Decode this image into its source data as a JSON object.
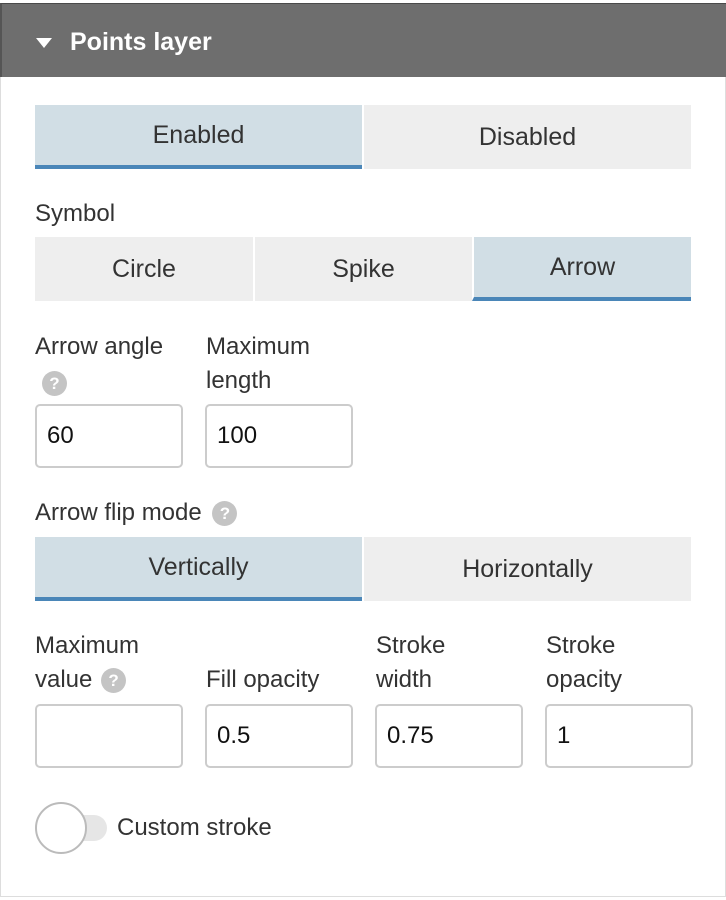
{
  "header": {
    "title": "Points layer"
  },
  "enabled_group": {
    "options": [
      "Enabled",
      "Disabled"
    ],
    "selected": "Enabled"
  },
  "symbol": {
    "label": "Symbol",
    "options": [
      "Circle",
      "Spike",
      "Arrow"
    ],
    "selected": "Arrow"
  },
  "arrow_angle": {
    "label": "Arrow angle",
    "value": "60",
    "help": "?"
  },
  "max_length": {
    "label_line1": "Maximum",
    "label_line2": "length",
    "value": "100"
  },
  "flip_mode": {
    "label": "Arrow flip mode",
    "help": "?",
    "options": [
      "Vertically",
      "Horizontally"
    ],
    "selected": "Vertically"
  },
  "max_value": {
    "label_line1": "Maximum",
    "label_line2": "value",
    "help": "?",
    "value": ""
  },
  "fill_opacity": {
    "label": "Fill opacity",
    "value": "0.5"
  },
  "stroke_width": {
    "label_line1": "Stroke",
    "label_line2": "width",
    "value": "0.75"
  },
  "stroke_opacity": {
    "label_line1": "Stroke",
    "label_line2": "opacity",
    "value": "1"
  },
  "custom_stroke": {
    "label": "Custom stroke",
    "on": false
  }
}
